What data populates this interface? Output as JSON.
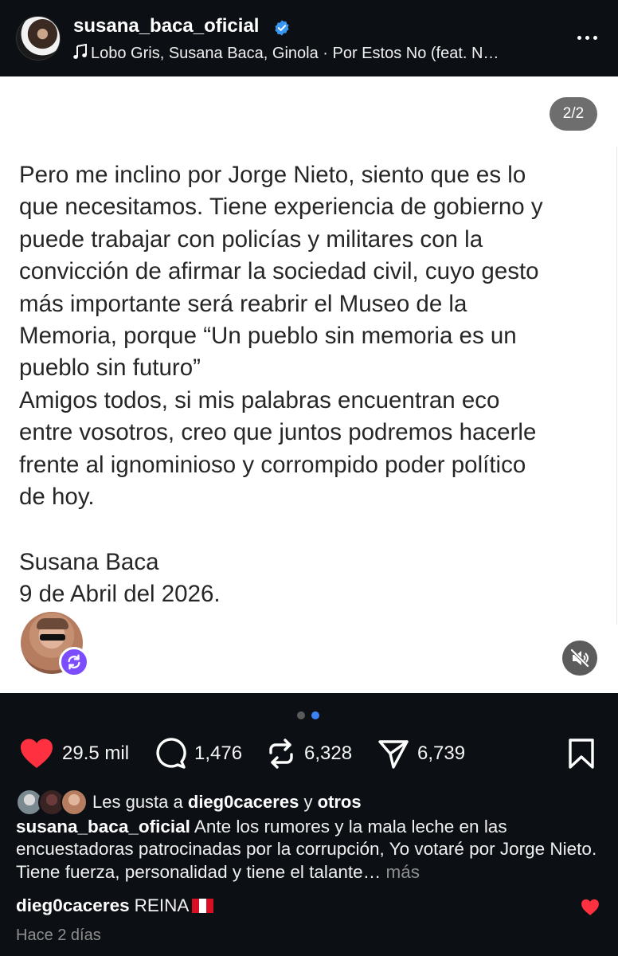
{
  "header": {
    "username": "susana_baca_oficial",
    "audio": "Lobo Gris, Susana Baca, Ginola · Por Estos No (feat. N…",
    "icons": [
      "verified-badge-icon",
      "music-note-icon",
      "more-options-icon"
    ]
  },
  "post": {
    "page_counter": "2/2",
    "letter_text": "Pero me inclino por Jorge Nieto, siento que es lo\nque necesitamos. Tiene experiencia de gobierno y\npuede trabajar con policías y militares con la\nconvicción de afirmar la sociedad civil, cuyo gesto\nmás importante será reabrir el Museo de la\nMemoria, porque “Un pueblo sin memoria es un\npueblo sin futuro”\n Amigos todos, si mis palabras encuentran eco\nentre vosotros, creo que juntos podremos hacerle\nfrente al ignominioso y corrompido poder político\nde hoy.",
    "signature_name": "Susana Baca",
    "signature_date": "9 de Abril del 2026.",
    "icons": [
      "repost-icon",
      "muted-speaker-icon"
    ]
  },
  "carousel": {
    "total": 2,
    "active": 2,
    "active_color": "#3b82f6",
    "inactive_color": "#5a5a5a"
  },
  "actions": {
    "likes": "29.5 mil",
    "comments": "1,476",
    "reposts": "6,328",
    "shares": "6,739",
    "like_color": "#ff3040"
  },
  "liked_by": {
    "prefix": "Les gusta a",
    "user": "dieg0caceres",
    "connector": "y",
    "others": "otros"
  },
  "caption": {
    "username": "susana_baca_oficial",
    "text": "Ante los rumores y la mala leche en las encuestadoras patrocinadas por la corrupción, Yo votaré por Jorge Nieto. Tiene fuerza, personalidad y tiene el talante…",
    "more": "más"
  },
  "comment": {
    "username": "dieg0caceres",
    "text": "REINA"
  },
  "timestamp": "Hace 2 días"
}
